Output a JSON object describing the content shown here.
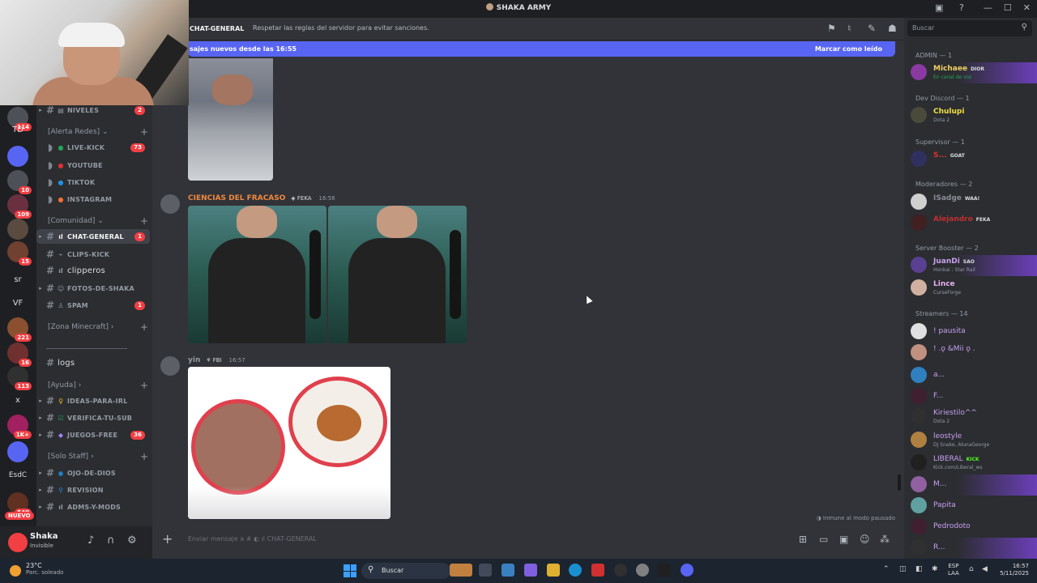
{
  "window": {
    "title": "SHAKA ARMY",
    "controls": [
      "—",
      "☐",
      "✕"
    ]
  },
  "server_rail": {
    "items": [
      {
        "label": "",
        "badge": "114"
      },
      {
        "label": "TD",
        "badge": ""
      },
      {
        "label": "",
        "badge": ""
      },
      {
        "label": "",
        "badge": "10"
      },
      {
        "label": "",
        "badge": "109"
      },
      {
        "label": "",
        "badge": ""
      },
      {
        "label": "",
        "badge": "15"
      },
      {
        "label": "sr",
        "badge": ""
      },
      {
        "label": "VF",
        "badge": ""
      },
      {
        "label": "",
        "badge": "221"
      },
      {
        "label": "",
        "badge": "16"
      },
      {
        "label": "",
        "badge": "113"
      },
      {
        "label": "x",
        "badge": ""
      },
      {
        "label": "",
        "badge": "1K+"
      },
      {
        "label": "",
        "badge": ""
      },
      {
        "label": "EsdC",
        "badge": ""
      },
      {
        "label": "",
        "badge": "540"
      }
    ],
    "nuevo": "NUEVO"
  },
  "channels": {
    "niveles": {
      "label": "NIVELES",
      "badge": "2"
    },
    "cat_alerta": "[Alerta Redes]",
    "live_kick": {
      "label": "LIVE-KICK",
      "badge": "73"
    },
    "youtube": {
      "label": "YOUTUBE"
    },
    "tiktok": {
      "label": "TIKTOK"
    },
    "instagram": {
      "label": "INSTAGRAM"
    },
    "cat_comunidad": "[Comunidad]",
    "chat_general": {
      "label": "CHAT-GENERAL",
      "badge": "1"
    },
    "clips_kick": {
      "label": "CLIPS-KICK"
    },
    "clipperos": {
      "label": "clipperos"
    },
    "fotos": {
      "label": "FOTOS-DE-SHAKA"
    },
    "spam": {
      "label": "SPAM",
      "badge": "1"
    },
    "cat_minecraft": "[Zona Minecraft]",
    "logs": {
      "label": "logs"
    },
    "cat_ayuda": "[Ayuda]",
    "ideas": {
      "label": "IDEAS-PARA-IRL"
    },
    "verifica": {
      "label": "VERIFICA-TU-SUB"
    },
    "juegos": {
      "label": "JUEGOS-FREE",
      "badge": "36"
    },
    "cat_staff": "[Solo Staff]",
    "ojo": {
      "label": "OJO-DE-DIOS"
    },
    "revision": {
      "label": "REVISION"
    },
    "adms": {
      "label": "ADMS-Y-MODS"
    }
  },
  "user": {
    "name": "Shaka",
    "status": "Invisible"
  },
  "header": {
    "channel": "CHAT-GENERAL",
    "topic": "Respetar las reglas del servidor para evitar sanciones."
  },
  "new_messages": {
    "text": "sajes nuevos desde las 16:55",
    "action": "Marcar como leído"
  },
  "messages": [
    {
      "author": "CIENCIAS DEL FRACASO",
      "tag": "FEKA",
      "time": "16:56",
      "color": "#f0883e"
    },
    {
      "author": "yin",
      "tag": "FBI",
      "time": "16:57",
      "color": "#949ba4"
    }
  ],
  "paused_note": "Inmune al modo pausado",
  "composer": {
    "placeholder": "Enviar mensaje a #",
    "channel": "CHAT-GENERAL"
  },
  "members": {
    "search_placeholder": "Buscar",
    "sections": [
      {
        "title": "ADMIN — 1"
      },
      {
        "title": "Dev Discord — 1"
      },
      {
        "title": "Supervisor — 1"
      },
      {
        "title": "Moderadores — 2"
      },
      {
        "title": "Server Booster — 2"
      },
      {
        "title": "Streamers — 14"
      }
    ],
    "list": [
      {
        "name": "Michaee",
        "tag": "DIOR",
        "sub": "En canal de voz",
        "color": "#f0d060"
      },
      {
        "name": "Chulupi",
        "tag": "",
        "sub": "Dota 2",
        "color": "#f0e040"
      },
      {
        "name": "S...",
        "tag": "GOAT",
        "sub": "",
        "color": "#e03030"
      },
      {
        "name": "ISadge",
        "tag": "WAA!",
        "sub": "",
        "color": "#8a8d94"
      },
      {
        "name": "Alejandro",
        "tag": "FEKA",
        "sub": "",
        "color": "#c03030"
      },
      {
        "name": "JuanDi",
        "tag": "SAO",
        "sub": "Honkai : Star Rail",
        "color": "#c9a0f0"
      },
      {
        "name": "Lince",
        "tag": "",
        "sub": "CurseForge",
        "color": "#e8b0f0"
      },
      {
        "name": "! pausita",
        "tag": "",
        "sub": "",
        "color": "#c9a0f0"
      },
      {
        "name": "! .ǫ &Mii ǫ .",
        "tag": "",
        "sub": "",
        "color": "#c9a0f0"
      },
      {
        "name": "a...",
        "tag": "",
        "sub": "",
        "color": "#c9a0f0"
      },
      {
        "name": "F...",
        "tag": "",
        "sub": "",
        "color": "#c9a0f0"
      },
      {
        "name": "Kiriestilo^^",
        "tag": "",
        "sub": "Dota 2",
        "color": "#c9a0f0"
      },
      {
        "name": "leostyle",
        "tag": "",
        "sub": "DJ Snake, AlunaGeorge",
        "color": "#c9a0f0"
      },
      {
        "name": "LIBERAL",
        "tag": "KICK",
        "sub": "Kick.com/Liberal_ws",
        "color": "#c9a0f0"
      },
      {
        "name": "M...",
        "tag": "",
        "sub": "",
        "color": "#c9a0f0"
      },
      {
        "name": "Papita",
        "tag": "",
        "sub": "",
        "color": "#c9a0f0"
      },
      {
        "name": "Pedrodoto",
        "tag": "",
        "sub": "",
        "color": "#c9a0f0"
      },
      {
        "name": "R...",
        "tag": "",
        "sub": "",
        "color": "#c9a0f0"
      }
    ]
  },
  "taskbar": {
    "temp": "23°C",
    "weather": "Parc. soleado",
    "search": "Buscar",
    "lang_top": "ESP",
    "lang_bottom": "LAA",
    "time": "16:57",
    "date": "5/11/2025"
  }
}
